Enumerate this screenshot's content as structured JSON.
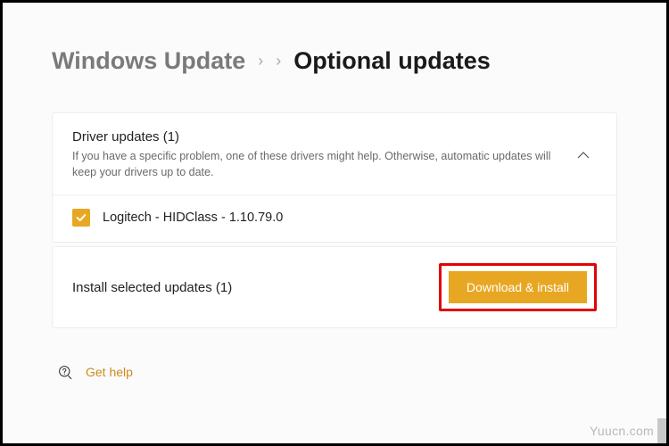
{
  "breadcrumb": {
    "parent": "Windows Update",
    "current": "Optional updates"
  },
  "section": {
    "title": "Driver updates (1)",
    "subtitle": "If you have a specific problem, one of these drivers might help. Otherwise, automatic updates will keep your drivers up to date."
  },
  "driver": {
    "name": "Logitech - HIDClass - 1.10.79.0",
    "checked": true
  },
  "install": {
    "label": "Install selected updates (1)",
    "button": "Download & install"
  },
  "help": {
    "label": "Get help"
  },
  "watermark": "Yuucn.com"
}
